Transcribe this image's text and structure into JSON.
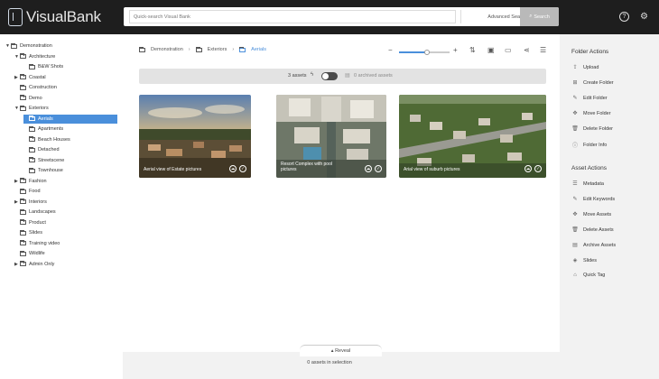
{
  "header": {
    "logo": "VisualBank",
    "search_placeholder": "Quick-search Visual Bank",
    "advanced_search": "Advanced Search",
    "search_button": "Search"
  },
  "tree": [
    {
      "label": "Demonstration",
      "depth": 0,
      "caret": "▼",
      "active": false
    },
    {
      "label": "Architecture",
      "depth": 1,
      "caret": "▼",
      "active": false
    },
    {
      "label": "B&W Shots",
      "depth": 2,
      "caret": "",
      "active": false
    },
    {
      "label": "Coastal",
      "depth": 1,
      "caret": "▶",
      "active": false
    },
    {
      "label": "Construction",
      "depth": 1,
      "caret": "",
      "active": false
    },
    {
      "label": "Demo",
      "depth": 1,
      "caret": "",
      "active": false
    },
    {
      "label": "Exteriors",
      "depth": 1,
      "caret": "▼",
      "active": false
    },
    {
      "label": "Aerials",
      "depth": 2,
      "caret": "",
      "active": true
    },
    {
      "label": "Apartments",
      "depth": 2,
      "caret": "",
      "active": false
    },
    {
      "label": "Beach Houses",
      "depth": 2,
      "caret": "",
      "active": false
    },
    {
      "label": "Detached",
      "depth": 2,
      "caret": "",
      "active": false
    },
    {
      "label": "Streetscene",
      "depth": 2,
      "caret": "",
      "active": false
    },
    {
      "label": "Townhouse",
      "depth": 2,
      "caret": "",
      "active": false
    },
    {
      "label": "Fashion",
      "depth": 1,
      "caret": "▶",
      "active": false
    },
    {
      "label": "Food",
      "depth": 1,
      "caret": "",
      "active": false
    },
    {
      "label": "Interiors",
      "depth": 1,
      "caret": "▶",
      "active": false
    },
    {
      "label": "Landscapes",
      "depth": 1,
      "caret": "",
      "active": false
    },
    {
      "label": "Product",
      "depth": 1,
      "caret": "",
      "active": false
    },
    {
      "label": "Slides",
      "depth": 1,
      "caret": "",
      "active": false
    },
    {
      "label": "Training video",
      "depth": 1,
      "caret": "",
      "active": false
    },
    {
      "label": "Wildlife",
      "depth": 1,
      "caret": "",
      "active": false
    },
    {
      "label": "Admin Only",
      "depth": 1,
      "caret": "▶",
      "active": false
    }
  ],
  "breadcrumb": [
    "Demonstration",
    "Exteriors",
    "Aerials"
  ],
  "zoom_level": 0.55,
  "assets_count": "3 assets",
  "archived_assets": "0 archived assets",
  "cards": [
    {
      "caption": "Aerial view of Estate pictures"
    },
    {
      "caption": "Resort Complex with pool pictures"
    },
    {
      "caption": "Arial view of suburb pictures"
    }
  ],
  "reveal": "Reveal",
  "selection_text": "0 assets in selection",
  "folder_actions_title": "Folder Actions",
  "folder_actions": [
    {
      "label": "Upload",
      "icon": "upload-icon"
    },
    {
      "label": "Create Folder",
      "icon": "folder-plus-icon"
    },
    {
      "label": "Edit Folder",
      "icon": "pencil-icon"
    },
    {
      "label": "Move Folder",
      "icon": "move-icon"
    },
    {
      "label": "Delete Folder",
      "icon": "trash-icon"
    },
    {
      "label": "Folder Info",
      "icon": "info-icon"
    }
  ],
  "asset_actions_title": "Asset Actions",
  "asset_actions": [
    {
      "label": "Metadata",
      "icon": "list-icon"
    },
    {
      "label": "Edit Keywords",
      "icon": "pencil-icon"
    },
    {
      "label": "Move Assets",
      "icon": "move-icon"
    },
    {
      "label": "Delete Assets",
      "icon": "trash-icon"
    },
    {
      "label": "Archive Assets",
      "icon": "archive-icon"
    },
    {
      "label": "Slides",
      "icon": "slides-icon"
    },
    {
      "label": "Quick Tag",
      "icon": "tag-icon"
    }
  ]
}
